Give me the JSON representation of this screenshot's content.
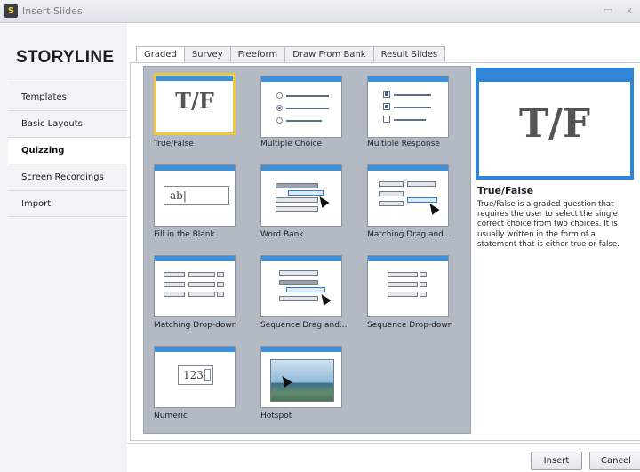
{
  "window": {
    "title": "Insert Slides",
    "minimize_glyph": "▭",
    "close_glyph": "x"
  },
  "brand": "STORYLINE",
  "sidebar": {
    "items": [
      {
        "label": "Templates"
      },
      {
        "label": "Basic Layouts"
      },
      {
        "label": "Quizzing",
        "active": true
      },
      {
        "label": "Screen Recordings"
      },
      {
        "label": "Import"
      }
    ]
  },
  "tabs": [
    {
      "label": "Graded",
      "active": true
    },
    {
      "label": "Survey"
    },
    {
      "label": "Freeform"
    },
    {
      "label": "Draw From Bank"
    },
    {
      "label": "Result Slides"
    }
  ],
  "tiles": [
    {
      "label": "True/False",
      "selected": true
    },
    {
      "label": "Multiple Choice"
    },
    {
      "label": "Multiple Response"
    },
    {
      "label": "Fill in the Blank"
    },
    {
      "label": "Word Bank"
    },
    {
      "label": "Matching Drag and..."
    },
    {
      "label": "Matching Drop-down"
    },
    {
      "label": "Sequence Drag and..."
    },
    {
      "label": "Sequence Drop-down"
    },
    {
      "label": "Numeric"
    },
    {
      "label": "Hotspot"
    }
  ],
  "thumb_text": {
    "tf": "T/F",
    "fill_blank": "ab|",
    "numeric": "123"
  },
  "preview": {
    "glyph": "T/F",
    "title": "True/False",
    "description": "True/False is a graded question that requires the user to select the single correct choice from two choices.  It is usually written in the form of a statement that is either true or false."
  },
  "buttons": {
    "insert": "Insert",
    "cancel": "Cancel"
  },
  "colors": {
    "accent_blue": "#2f86d8",
    "selection_gold": "#f2c73c",
    "gallery_bg": "#b3bac4"
  }
}
